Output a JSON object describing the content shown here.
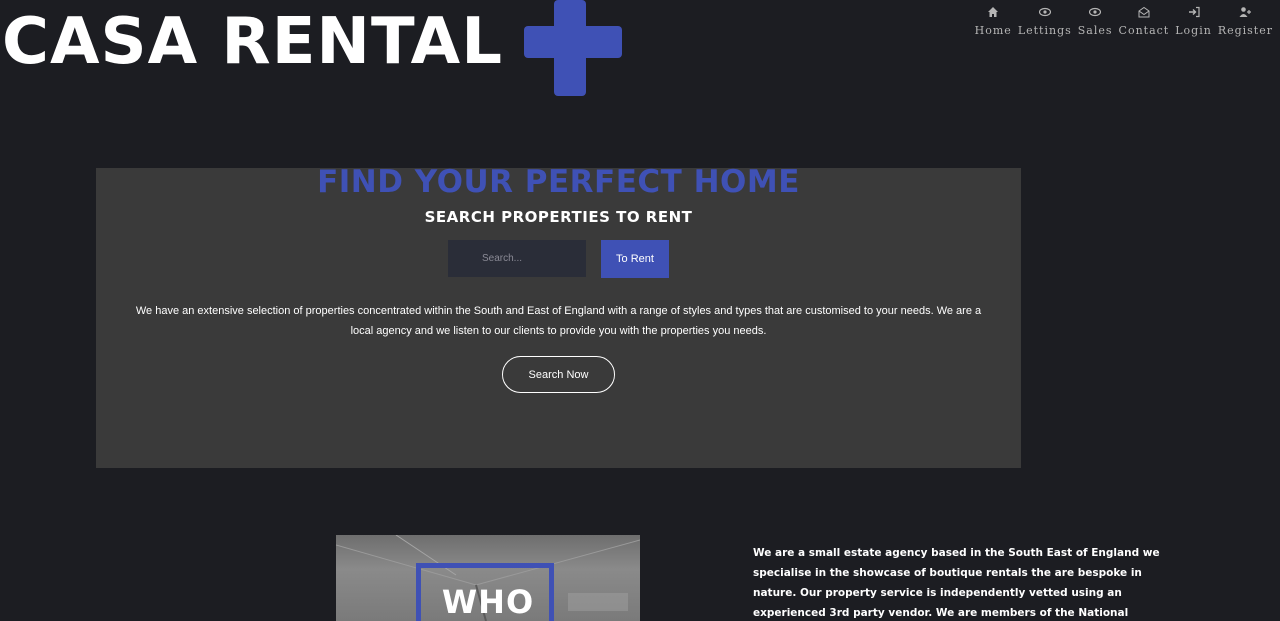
{
  "brand": {
    "logo_text": "CASA RENTAL",
    "accent_color": "#3f51b5"
  },
  "nav": {
    "items": [
      {
        "label": "Home",
        "icon": "home-icon"
      },
      {
        "label": "Lettings",
        "icon": "eye-icon"
      },
      {
        "label": "Sales",
        "icon": "eye-icon"
      },
      {
        "label": "Contact",
        "icon": "envelope-icon"
      },
      {
        "label": "Login",
        "icon": "sign-in-icon"
      },
      {
        "label": "Register",
        "icon": "user-plus-icon"
      }
    ]
  },
  "hero": {
    "title": "FIND YOUR PERFECT HOME",
    "subtitle": "SEARCH PROPERTIES TO RENT",
    "search_placeholder": "Search...",
    "to_rent_label": "To Rent",
    "description": "We have an extensive selection of properties concentrated within the South and East of England with a range of styles and types that are customised to your needs. We are a local agency and we listen to our clients to provide you with the properties you needs.",
    "search_now_label": "Search Now"
  },
  "who": {
    "image_text": "WHO",
    "about": "We are a small estate agency based in the South East of England we specialise in the showcase of boutique rentals the are bespoke in nature. Our property service is independently vetted using an experienced 3rd party vendor. We are members of the National Association of Estate Agents we"
  }
}
